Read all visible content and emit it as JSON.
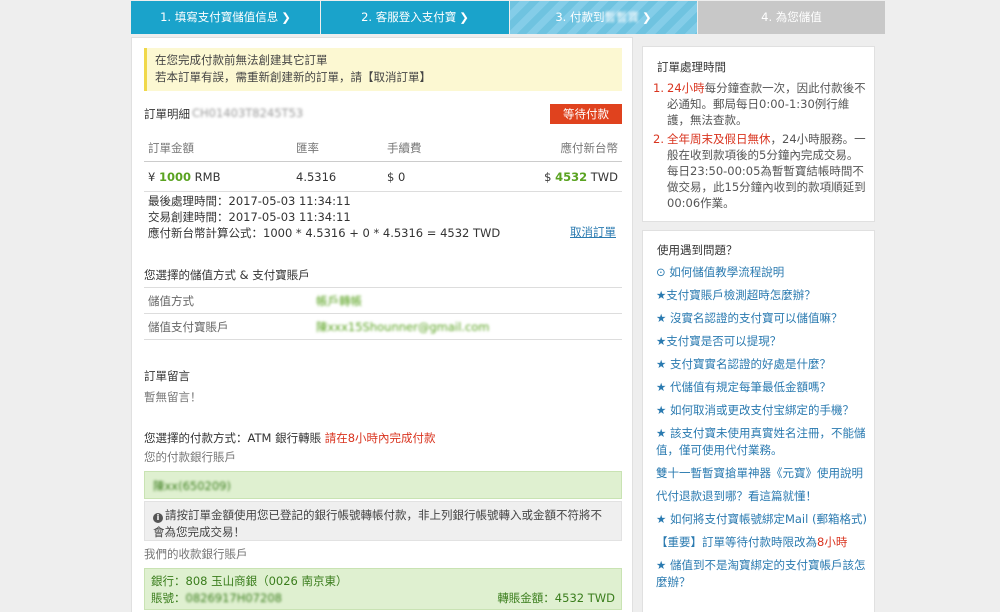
{
  "steps": [
    {
      "label": "1. 填寫支付寶儲值信息",
      "chev": "❯"
    },
    {
      "label": "2. 客服登入支付寶",
      "chev": "❯"
    },
    {
      "label": "3. 付款到",
      "label_b": "暫暫寶",
      "chev": "❯"
    },
    {
      "label": "4. 為您儲值"
    }
  ],
  "notice": {
    "line1": "在您完成付款前無法創建其它訂單",
    "line2": "若本訂單有誤，需重新創建新的訂單，請【取消訂單】"
  },
  "order": {
    "label": "訂單明細",
    "id": "CH01403T8245T53",
    "status": "等待付款",
    "headers": [
      "訂單金額",
      "匯率",
      "手續費",
      "應付新台幣"
    ],
    "row": {
      "amount_prefix": "¥",
      "amount": "1000",
      "amount_unit": "RMB",
      "rate": "4.5316",
      "fee": "$ 0",
      "twd_prefix": "$",
      "twd": "4532",
      "twd_unit": "TWD"
    },
    "last_processed": "最後處理時間：2017-05-03 11:34:11",
    "created": "交易創建時間：2017-05-03 11:34:11",
    "formula": "應付新台幣計算公式：1000 * 4.5316 + 0 * 4.5316 = 4532 TWD",
    "cancel_link": "取消訂單"
  },
  "deposit": {
    "title": "您選擇的儲值方式 & 支付寶賬戶",
    "method_label": "儲值方式",
    "method_value": "帳戶轉帳",
    "account_label": "儲值支付寶賬戶",
    "account_value": "陳xxx15Shounner@gmail.com"
  },
  "memo": {
    "title": "訂單留言",
    "value": "暫無留言！"
  },
  "payment": {
    "title_prefix": "您選擇的付款方式：ATM 銀行轉賬",
    "title_warning": "請在8小時內完成付款",
    "your_account_label": "您的付款銀行賬戶",
    "your_account_value": "陳xx(650209)",
    "info_text": "請按訂單金額使用您已登記的銀行帳號轉帳付款，非上列銀行帳號轉入或金額不符將不會為您完成交易！",
    "info_icon": "i",
    "receive_label": "我們的收款銀行賬戶",
    "bank_line": "銀行：808 玉山商銀（0026 南京東）",
    "account_line_label": "賬號：",
    "account_line_value": "0826917H07208",
    "transfer_amount": "轉賬金額：4532 TWD"
  },
  "side_time": {
    "title": "訂單處理時間",
    "items": [
      {
        "num": "1.",
        "hot": "24小時",
        "text": "每分鐘查款一次，因此付款後不必通知。郵局每日0:00-1:30例行維護，無法查款。"
      },
      {
        "num": "2.",
        "hot": "全年周末及假日無休",
        "text": "，24小時服務。一般在收到款項後的5分鐘內完成交易。每日23:50-00:05為暫暫寶結帳時間不做交易，此15分鐘內收到的款項順延到00:06作業。"
      }
    ]
  },
  "side_help": {
    "title": "使用遇到問題？",
    "links": [
      "⊙ 如何儲值教學流程說明",
      "★支付寶賬戶檢測超時怎麼辦？",
      "★ 沒實名認證的支付寶可以儲值嘛？",
      "★支付寶是否可以提現？",
      "★ 支付寶實名認證的好處是什麼？",
      "★ 代儲值有規定每筆最低金額嗎？",
      "★ 如何取消或更改支付宝綁定的手機？",
      "★ 該支付寶未使用真實姓名注冊，不能儲值，僅可使用代付業務。",
      "雙十一暫暫寶搶單神器《元寶》使用說明",
      "代付退款退到哪？看這篇就懂！",
      "★ 如何將支付寶帳號綁定Mail (郵箱格式)"
    ],
    "important_prefix": "【重要】訂單等待付款時限改為",
    "important_hot": "8小時",
    "last_link": "★ 儲值到不是淘寶綁定的支付寶帳戶該怎麼辦？"
  }
}
